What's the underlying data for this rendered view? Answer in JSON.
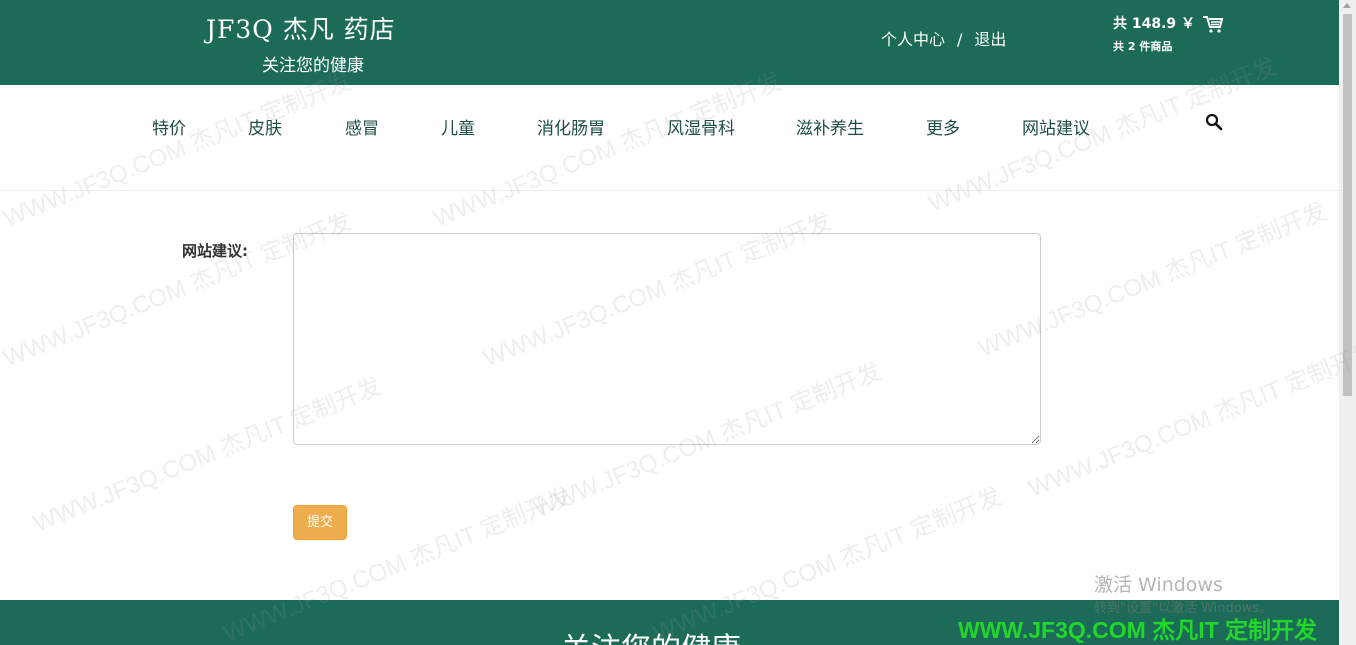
{
  "header": {
    "logo_title": "JF3Q 杰凡 药店",
    "logo_subtitle": "关注您的健康",
    "user_center": "个人中心",
    "separator": "/",
    "logout": "退出",
    "cart_total": "共 148.9 ￥",
    "cart_count": "共 2 件商品",
    "cart_icon": "cart-icon"
  },
  "nav": {
    "items": [
      "特价",
      "皮肤",
      "感冒",
      "儿童",
      "消化肠胃",
      "风湿骨科",
      "滋补养生",
      "更多",
      "网站建议"
    ],
    "search_icon": "search-icon"
  },
  "form": {
    "label": "网站建议:",
    "textarea_value": "",
    "submit_label": "提交"
  },
  "footer": {
    "slogan": "关注您的健康"
  },
  "watermark": {
    "text": "WWW.JF3Q.COM 杰凡IT  定制开发",
    "activate_title": "激活 Windows",
    "activate_sub": "转到\"设置\"以激活 Windows。",
    "stamp": "WWW.JF3Q.COM 杰凡IT  定制开发"
  },
  "colors": {
    "header_bg": "#1c6b59",
    "nav_text": "#1e4d44",
    "submit_bg": "#f0ad4e",
    "stamp_green": "#22d62a"
  }
}
